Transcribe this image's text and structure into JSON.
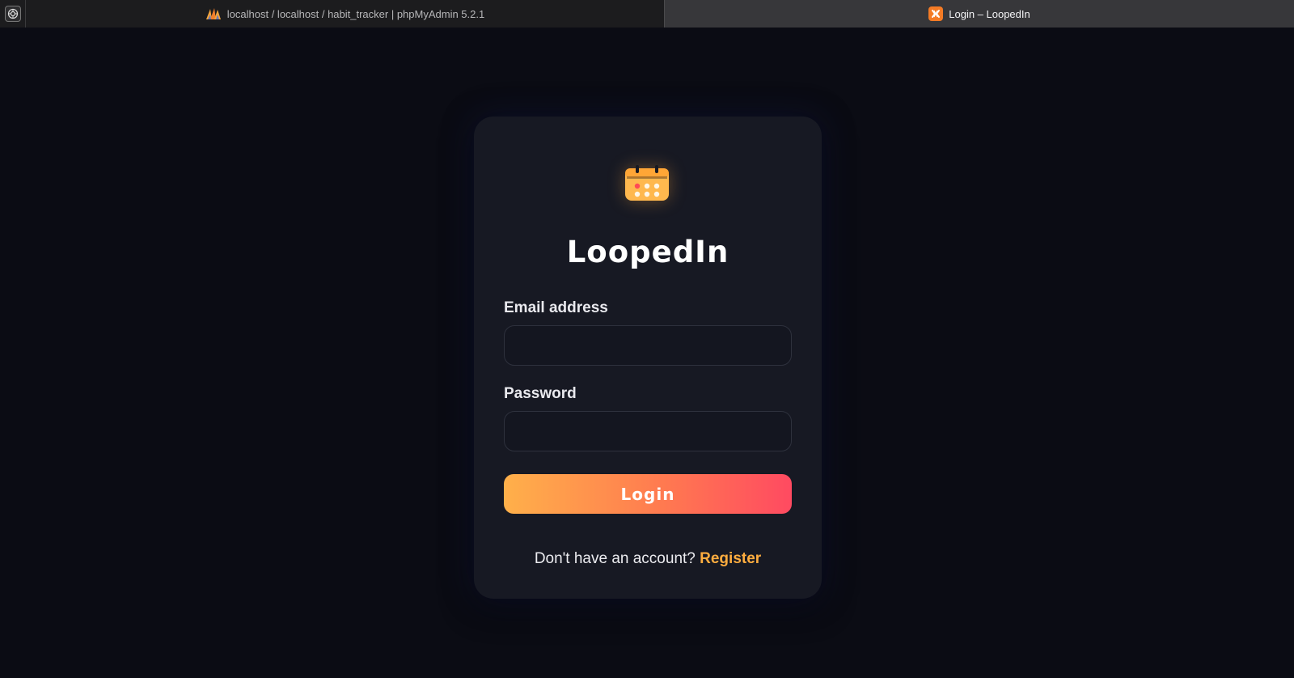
{
  "browser": {
    "tabs": [
      {
        "title": "localhost / localhost / habit_tracker | phpMyAdmin 5.2.1",
        "icon": "phpmyadmin-icon",
        "active": false
      },
      {
        "title": "Login – LoopedIn",
        "icon": "xampp-icon",
        "active": true
      }
    ],
    "pinned_icon": "chatgpt-icon"
  },
  "login": {
    "logo_icon": "calendar-icon",
    "brand": "LoopedIn",
    "email_label": "Email address",
    "email_value": "",
    "password_label": "Password",
    "password_value": "",
    "login_button": "Login",
    "register_prompt": "Don't have an account?",
    "register_link": "Register"
  },
  "colors": {
    "background": "#0b0c14",
    "card": "#171923",
    "accent_orange": "#ffad3f",
    "accent_red": "#ff4a61"
  }
}
